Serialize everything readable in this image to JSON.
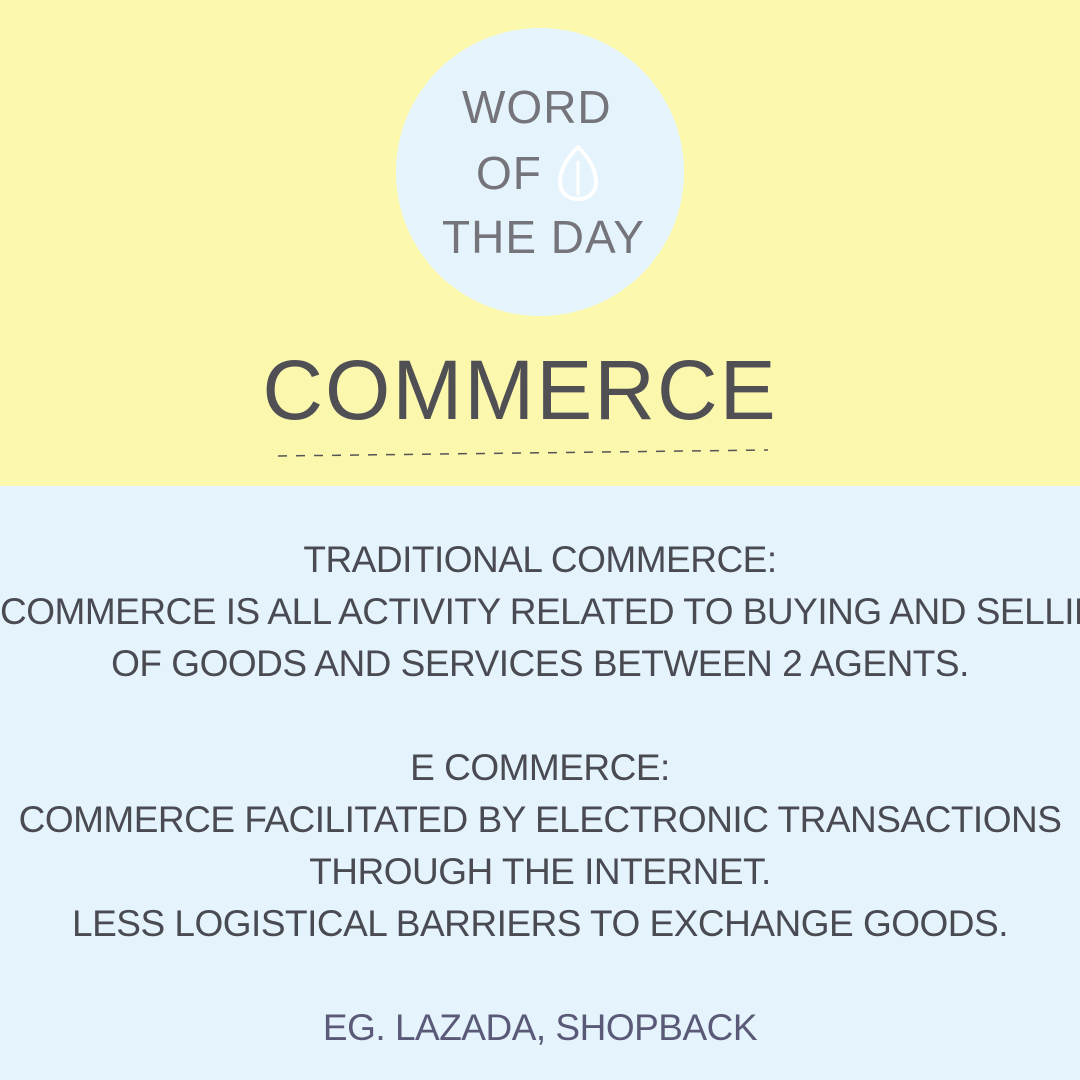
{
  "badge": {
    "line1": "WORD",
    "line2": "OF",
    "line3": "THE DAY",
    "icon": "seed-icon"
  },
  "word": "COMMERCE",
  "colors": {
    "top_background": "#fbf7ad",
    "bottom_background": "#e4f3fc",
    "circle": "#e4f3fc",
    "text": "#4a4a52"
  },
  "traditional": {
    "heading": "TRADITIONAL COMMERCE:",
    "lines": [
      "COMMERCE IS ALL ACTIVITY RELATED TO BUYING AND SELLING",
      "OF GOODS AND SERVICES BETWEEN 2 AGENTS."
    ]
  },
  "ecommerce": {
    "heading": "E COMMERCE:",
    "lines": [
      "COMMERCE FACILITATED BY ELECTRONIC TRANSACTIONS",
      "THROUGH THE INTERNET.",
      "LESS LOGISTICAL BARRIERS TO EXCHANGE GOODS."
    ],
    "example": "EG. LAZADA, SHOPBACK"
  }
}
